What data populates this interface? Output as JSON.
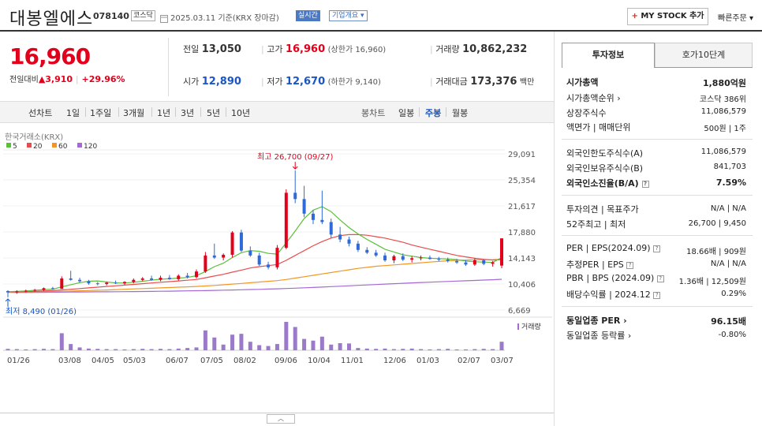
{
  "stock": {
    "name": "대봉엘에스",
    "code": "078140",
    "market_badge": "코스닥",
    "date_text": "2025.03.11 기준(KRX 장마감)",
    "realtime_badge": "실시간",
    "corp_overview": "기업개요 ▾"
  },
  "actions": {
    "my_stock": "MY STOCK 추가",
    "my_stock_plus": "+",
    "quick_order": "빠른주문 ▾"
  },
  "price": {
    "current": "16,960",
    "diff_label": "전일대비",
    "diff_arrow": "▲",
    "diff": "3,910",
    "diff_pct": "+29.96%"
  },
  "quote": {
    "prev_label": "전일",
    "prev": "13,050",
    "high_label": "고가",
    "high": "16,960",
    "upper_limit": "(상한가 16,960)",
    "volume_label": "거래량",
    "volume": "10,862,232",
    "open_label": "시가",
    "open": "12,890",
    "low_label": "저가",
    "low": "12,670",
    "lower_limit": "(하한가 9,140)",
    "amount_label": "거래대금",
    "amount": "173,376",
    "amount_unit": "백만"
  },
  "period": {
    "line_label": "선차트",
    "line_items": [
      "1일",
      "1주일",
      "3개월",
      "1년",
      "3년",
      "5년",
      "10년"
    ],
    "candle_label": "봉차트",
    "candle_items": [
      "일봉",
      "주봉",
      "월봉"
    ]
  },
  "tabs": {
    "invest_info": "투자정보",
    "orderbook": "호가10단계"
  },
  "invest": {
    "mcap_label": "시가총액",
    "mcap": "1,880억원",
    "mcap_rank_label": "시가총액순위 ›",
    "mcap_rank": "코스닥 386위",
    "shares_label": "상장주식수",
    "shares": "11,086,579",
    "par_label": "액면가 | 매매단위",
    "par": "500원 | 1주",
    "foreign_limit_label": "외국인한도주식수(A)",
    "foreign_limit": "11,086,579",
    "foreign_hold_label": "외국인보유주식수(B)",
    "foreign_hold": "841,703",
    "foreign_ratio_label": "외국인소진율(B/A)",
    "foreign_ratio": "7.59%",
    "opinion_label": "투자의견 | 목표주가",
    "opinion": "N/A | N/A",
    "range52_label": "52주최고 | 최저",
    "range52": "26,700 | 9,450",
    "per_label": "PER | EPS(2024.09)",
    "per": "18.66배 | 909원",
    "est_per_label": "추정PER | EPS",
    "est_per": "N/A | N/A",
    "pbr_label": "PBR | BPS (2024.09)",
    "pbr": "1.36배 | 12,509원",
    "div_label": "배당수익률 | 2024.12",
    "div": "0.29%",
    "sector_per_label": "동일업종 PER ›",
    "sector_per": "96.15배",
    "sector_rate_label": "동일업종 등락률 ›",
    "sector_rate": "-0.80%"
  },
  "chart_data": {
    "type": "candlestick",
    "source_label": "한국거래소(KRX)",
    "legend": [
      {
        "name": "5",
        "color": "#5bbf3a"
      },
      {
        "name": "20",
        "color": "#e84c4c"
      },
      {
        "name": "60",
        "color": "#f29727"
      },
      {
        "name": "120",
        "color": "#a26ad2"
      }
    ],
    "y_ticks": [
      "29,091",
      "25,354",
      "21,617",
      "17,880",
      "14,143",
      "10,406",
      "6,669"
    ],
    "ylim": [
      6669,
      29091
    ],
    "x_labels": [
      "01/26",
      "03/08",
      "04/05",
      "05/03",
      "06/07",
      "07/05",
      "08/02",
      "09/06",
      "10/04",
      "11/01",
      "12/06",
      "01/03",
      "02/07",
      "03/07"
    ],
    "high_annotation": "최고 26,700 (09/27)",
    "low_annotation": "최저 8,490 (01/26)",
    "volume_label": "거래량",
    "up_color": "#e3001b",
    "down_color": "#2e6ad8",
    "candles": [
      {
        "o": 9400,
        "h": 9500,
        "l": 8490,
        "c": 9200
      },
      {
        "o": 9200,
        "h": 9500,
        "l": 9000,
        "c": 9350
      },
      {
        "o": 9350,
        "h": 9600,
        "l": 9200,
        "c": 9450
      },
      {
        "o": 9450,
        "h": 9700,
        "l": 9300,
        "c": 9550
      },
      {
        "o": 9550,
        "h": 9900,
        "l": 9400,
        "c": 9800
      },
      {
        "o": 9800,
        "h": 10000,
        "l": 9600,
        "c": 9700
      },
      {
        "o": 9700,
        "h": 11500,
        "l": 9700,
        "c": 11200
      },
      {
        "o": 11200,
        "h": 12300,
        "l": 10900,
        "c": 11000
      },
      {
        "o": 11000,
        "h": 11300,
        "l": 10600,
        "c": 10800
      },
      {
        "o": 10800,
        "h": 11000,
        "l": 10300,
        "c": 10500
      },
      {
        "o": 10500,
        "h": 10700,
        "l": 10200,
        "c": 10400
      },
      {
        "o": 10400,
        "h": 10700,
        "l": 10200,
        "c": 10600
      },
      {
        "o": 10600,
        "h": 10900,
        "l": 10400,
        "c": 10500
      },
      {
        "o": 10500,
        "h": 10800,
        "l": 10300,
        "c": 10700
      },
      {
        "o": 10700,
        "h": 11200,
        "l": 10500,
        "c": 11000
      },
      {
        "o": 11000,
        "h": 11400,
        "l": 10800,
        "c": 11200
      },
      {
        "o": 11200,
        "h": 11600,
        "l": 10900,
        "c": 11000
      },
      {
        "o": 11000,
        "h": 11600,
        "l": 10800,
        "c": 11300
      },
      {
        "o": 11300,
        "h": 11700,
        "l": 11000,
        "c": 11100
      },
      {
        "o": 11100,
        "h": 11800,
        "l": 10900,
        "c": 11600
      },
      {
        "o": 11600,
        "h": 12000,
        "l": 11200,
        "c": 11400
      },
      {
        "o": 11400,
        "h": 12500,
        "l": 11200,
        "c": 12200
      },
      {
        "o": 12200,
        "h": 15000,
        "l": 12000,
        "c": 14500
      },
      {
        "o": 14500,
        "h": 16200,
        "l": 14000,
        "c": 14200
      },
      {
        "o": 14200,
        "h": 14800,
        "l": 13800,
        "c": 14600
      },
      {
        "o": 14600,
        "h": 18000,
        "l": 14200,
        "c": 17800
      },
      {
        "o": 17800,
        "h": 18200,
        "l": 15000,
        "c": 15200
      },
      {
        "o": 15200,
        "h": 15800,
        "l": 14300,
        "c": 14500
      },
      {
        "o": 14500,
        "h": 14900,
        "l": 13000,
        "c": 13200
      },
      {
        "o": 13200,
        "h": 13600,
        "l": 12500,
        "c": 12800
      },
      {
        "o": 12800,
        "h": 16000,
        "l": 12500,
        "c": 15600
      },
      {
        "o": 15600,
        "h": 24000,
        "l": 15400,
        "c": 23500
      },
      {
        "o": 23500,
        "h": 26700,
        "l": 22000,
        "c": 22600
      },
      {
        "o": 22600,
        "h": 24500,
        "l": 20000,
        "c": 20500
      },
      {
        "o": 20500,
        "h": 21000,
        "l": 19000,
        "c": 19600
      },
      {
        "o": 19600,
        "h": 23800,
        "l": 19000,
        "c": 19300
      },
      {
        "o": 19300,
        "h": 19800,
        "l": 17000,
        "c": 17500
      },
      {
        "o": 17500,
        "h": 18600,
        "l": 16400,
        "c": 16800
      },
      {
        "o": 16800,
        "h": 17200,
        "l": 15800,
        "c": 16200
      },
      {
        "o": 16200,
        "h": 16600,
        "l": 15000,
        "c": 15300
      },
      {
        "o": 15300,
        "h": 15700,
        "l": 14700,
        "c": 14900
      },
      {
        "o": 14900,
        "h": 15300,
        "l": 14300,
        "c": 14500
      },
      {
        "o": 14500,
        "h": 14900,
        "l": 13600,
        "c": 13800
      },
      {
        "o": 13800,
        "h": 14600,
        "l": 13400,
        "c": 14400
      },
      {
        "o": 14400,
        "h": 14800,
        "l": 13700,
        "c": 13900
      },
      {
        "o": 13900,
        "h": 14400,
        "l": 13500,
        "c": 14100
      },
      {
        "o": 14100,
        "h": 14500,
        "l": 13800,
        "c": 14200
      },
      {
        "o": 14200,
        "h": 14500,
        "l": 13900,
        "c": 14000
      },
      {
        "o": 14000,
        "h": 14300,
        "l": 13700,
        "c": 13900
      },
      {
        "o": 13900,
        "h": 14200,
        "l": 13500,
        "c": 13700
      },
      {
        "o": 13700,
        "h": 14000,
        "l": 13300,
        "c": 13500
      },
      {
        "o": 13500,
        "h": 13800,
        "l": 13000,
        "c": 13200
      },
      {
        "o": 13200,
        "h": 14100,
        "l": 13000,
        "c": 13800
      },
      {
        "o": 13800,
        "h": 14000,
        "l": 13100,
        "c": 13300
      },
      {
        "o": 13300,
        "h": 13700,
        "l": 12900,
        "c": 13500
      },
      {
        "o": 13050,
        "h": 16960,
        "l": 12670,
        "c": 16960
      }
    ],
    "ma5": [
      9300,
      9350,
      9400,
      9500,
      9600,
      9650,
      10000,
      10300,
      10600,
      10800,
      10850,
      10700,
      10550,
      10550,
      10650,
      10800,
      10950,
      11100,
      11150,
      11250,
      11350,
      11600,
      12200,
      12900,
      13400,
      14200,
      14900,
      15200,
      15100,
      14800,
      14700,
      16300,
      18000,
      19800,
      21000,
      21500,
      20800,
      19600,
      18500,
      17600,
      16800,
      16100,
      15400,
      15000,
      14600,
      14400,
      14200,
      14100,
      14050,
      14000,
      13900,
      13700,
      13600,
      13550,
      13500,
      14200
    ],
    "ma20": [
      9300,
      9300,
      9320,
      9350,
      9400,
      9450,
      9550,
      9650,
      9750,
      9850,
      9950,
      10050,
      10150,
      10250,
      10350,
      10450,
      10550,
      10650,
      10750,
      10850,
      10950,
      11050,
      11300,
      11550,
      11800,
      12100,
      12400,
      12700,
      12900,
      13050,
      13200,
      13800,
      14500,
      15200,
      15900,
      16500,
      17000,
      17350,
      17500,
      17500,
      17400,
      17200,
      17000,
      16700,
      16400,
      16000,
      15700,
      15400,
      15100,
      14800,
      14500,
      14300,
      14100,
      13950,
      13850,
      13900
    ],
    "ma60": [
      9250,
      9260,
      9270,
      9280,
      9300,
      9320,
      9350,
      9390,
      9430,
      9470,
      9510,
      9550,
      9600,
      9650,
      9700,
      9750,
      9800,
      9850,
      9900,
      9950,
      10000,
      10050,
      10120,
      10200,
      10290,
      10390,
      10490,
      10590,
      10690,
      10790,
      10890,
      11050,
      11250,
      11450,
      11650,
      11850,
      12050,
      12250,
      12450,
      12650,
      12800,
      12950,
      13050,
      13150,
      13250,
      13350,
      13450,
      13550,
      13650,
      13730,
      13800,
      13850,
      13870,
      13880,
      13890,
      13950
    ],
    "ma120": [
      9200,
      9200,
      9200,
      9210,
      9220,
      9230,
      9240,
      9250,
      9260,
      9270,
      9280,
      9290,
      9300,
      9310,
      9320,
      9330,
      9340,
      9360,
      9380,
      9400,
      9420,
      9440,
      9460,
      9490,
      9520,
      9550,
      9580,
      9610,
      9640,
      9680,
      9720,
      9760,
      9810,
      9860,
      9910,
      9970,
      10030,
      10090,
      10150,
      10210,
      10270,
      10330,
      10390,
      10450,
      10510,
      10570,
      10620,
      10670,
      10720,
      10770,
      10820,
      10870,
      10920,
      10970,
      11020,
      11080
    ],
    "volume": [
      5,
      4,
      3,
      4,
      5,
      4,
      60,
      22,
      10,
      6,
      5,
      4,
      4,
      3,
      4,
      5,
      4,
      5,
      4,
      6,
      8,
      10,
      70,
      45,
      20,
      55,
      58,
      30,
      18,
      15,
      22,
      100,
      82,
      40,
      34,
      48,
      20,
      25,
      24,
      8,
      6,
      5,
      6,
      4,
      5,
      6,
      4,
      3,
      4,
      5,
      3,
      3,
      4,
      5,
      4,
      30
    ]
  }
}
